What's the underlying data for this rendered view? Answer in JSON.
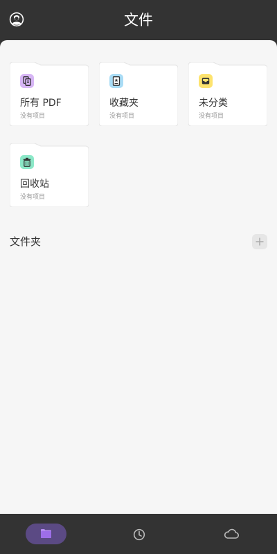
{
  "header": {
    "title": "文件",
    "avatar_icon": "user-avatar-icon"
  },
  "cards": [
    {
      "name": "所有 PDF",
      "sub": "没有项目",
      "icon": "pdf-documents-icon",
      "icon_color": "#d7b6f5"
    },
    {
      "name": "收藏夹",
      "sub": "没有项目",
      "icon": "bookmark-document-icon",
      "icon_color": "#a9dcf5"
    },
    {
      "name": "未分类",
      "sub": "没有项目",
      "icon": "inbox-tray-icon",
      "icon_color": "#fde36e"
    },
    {
      "name": "回收站",
      "sub": "没有项目",
      "icon": "trash-bin-icon",
      "icon_color": "#8ce8c8"
    }
  ],
  "section": {
    "title": "文件夹",
    "add_icon": "plus-icon"
  },
  "bottom_nav": {
    "active": "files",
    "items": [
      {
        "id": "files",
        "icon": "folder-icon"
      },
      {
        "id": "recent",
        "icon": "clock-icon"
      },
      {
        "id": "cloud",
        "icon": "cloud-icon"
      }
    ]
  },
  "colors": {
    "header_bg": "#333333",
    "content_bg": "#f6f6f6",
    "accent": "#5b4a84"
  }
}
